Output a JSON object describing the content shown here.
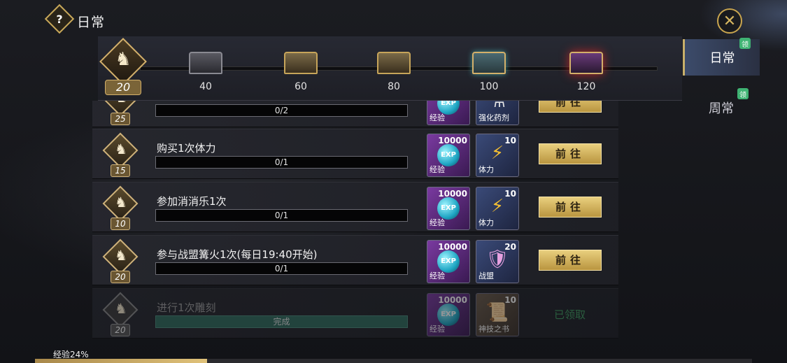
{
  "header": {
    "title": "日常",
    "help_icon": "question-mark-icon",
    "close_icon": "close-x-icon"
  },
  "side_tabs": [
    {
      "label": "日常",
      "active": true,
      "badge": "领"
    },
    {
      "label": "周常",
      "active": false,
      "badge": "领"
    }
  ],
  "activity": {
    "current_points": "20",
    "progress_fraction": 0.0,
    "milestones": [
      {
        "points": "40",
        "chest": "iron-chest-icon"
      },
      {
        "points": "60",
        "chest": "bronze-chest-icon"
      },
      {
        "points": "80",
        "chest": "gold-chest-icon"
      },
      {
        "points": "100",
        "chest": "teal-chest-icon"
      },
      {
        "points": "120",
        "chest": "purple-chest-icon"
      }
    ]
  },
  "tasks": [
    {
      "points": "25",
      "name": "",
      "progress": "0/2",
      "rewards": [
        {
          "count": "",
          "name": "经验"
        },
        {
          "count": "",
          "name": "强化药剂"
        }
      ],
      "button": "前往",
      "status": "partial"
    },
    {
      "points": "15",
      "name": "购买1次体力",
      "progress": "0/1",
      "rewards": [
        {
          "count": "10000",
          "name": "经验"
        },
        {
          "count": "10",
          "name": "体力"
        }
      ],
      "button": "前往"
    },
    {
      "points": "10",
      "name": "参加消消乐1次",
      "progress": "0/1",
      "rewards": [
        {
          "count": "10000",
          "name": "经验"
        },
        {
          "count": "10",
          "name": "体力"
        }
      ],
      "button": "前往"
    },
    {
      "points": "20",
      "name": "参与战盟篝火1次(每日19:40开始)",
      "progress": "0/1",
      "rewards": [
        {
          "count": "10000",
          "name": "经验"
        },
        {
          "count": "20",
          "name": "战盟"
        }
      ],
      "button": "前往"
    },
    {
      "points": "20",
      "name": "进行1次雕刻",
      "progress": "完成",
      "rewards": [
        {
          "count": "10000",
          "name": "经验"
        },
        {
          "count": "10",
          "name": "神技之书"
        }
      ],
      "claimed_label": "已领取"
    }
  ],
  "exp_bar": {
    "label": "经验24%",
    "percent": 24
  },
  "colors": {
    "accent_gold": "#c7a55a",
    "claim_green": "#3fb373",
    "claimed_text": "#3d9a5e"
  }
}
